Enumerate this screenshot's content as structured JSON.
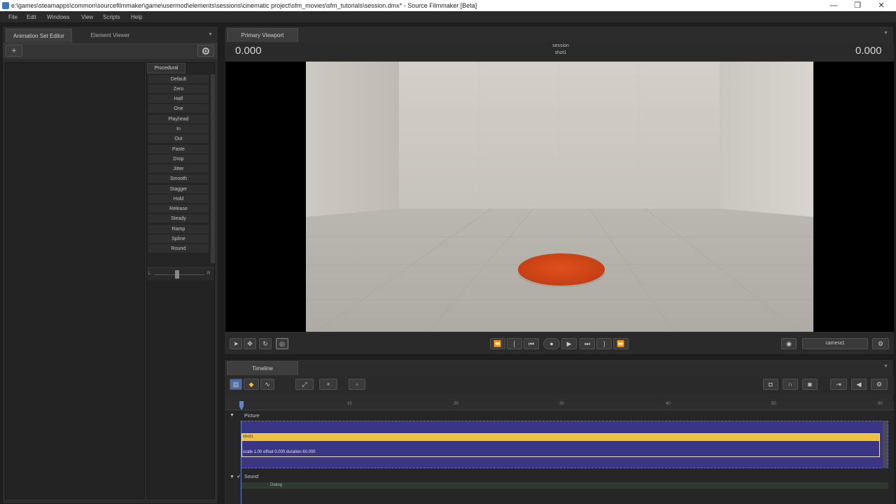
{
  "window": {
    "title": "e:\\games\\steamapps\\common\\sourcefilmmaker\\game\\usermod\\elements\\sessions\\cinematic project\\sfm_movies\\sfm_tutorials\\session.dmx* - Source Filmmaker [Beta]",
    "minimize": "—",
    "maximize": "❐",
    "close": "✕"
  },
  "menu": [
    "File",
    "Edit",
    "Windows",
    "View",
    "Scripts",
    "Help"
  ],
  "left_panel": {
    "tabs": [
      "Animation Set Editor",
      "Element Viewer"
    ],
    "add_button": "+",
    "procedural_header": "Procedural",
    "procedural_items": [
      "Default",
      "Zero",
      "Half",
      "One",
      "Playhead",
      "In",
      "Out",
      "Paste",
      "Drop",
      "Jitter",
      "Smooth",
      "Stagger",
      "Hold",
      "Release",
      "Steady",
      "Ramp",
      "Spline",
      "Round"
    ],
    "slider_left": "L",
    "slider_right": "R"
  },
  "viewport": {
    "tab": "Primary Viewport",
    "left_time": "0.000",
    "right_time": "0.000",
    "session_label": "session",
    "shot_label": "shot1",
    "camera_select": "camera1"
  },
  "timeline": {
    "tab": "Timeline",
    "ruler_ticks": [
      "10",
      "20",
      "30",
      "40",
      "50",
      "60"
    ],
    "picture_track": "Picture",
    "shot_name": "shot1",
    "shot_info": "scale 1.00 offset 0.000 duration 60.000",
    "sound_track": "Sound",
    "sound_clip": "Dialog"
  },
  "colors": {
    "accent_yellow": "#f0c03a",
    "clip_purple": "#3a3585",
    "disk_orange": "#d8461a"
  }
}
